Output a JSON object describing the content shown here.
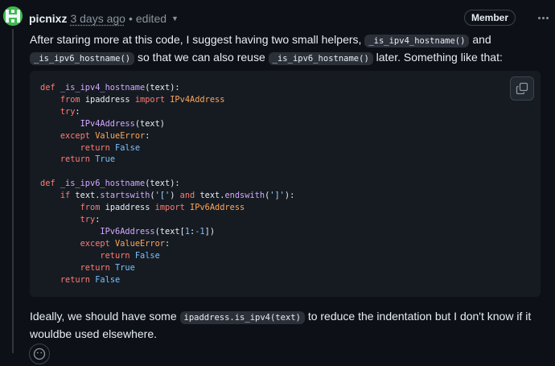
{
  "comment": {
    "author": "picnixz",
    "time": "3 days ago",
    "separator": "•",
    "edited": "edited",
    "badge": "Member",
    "paragraph1": {
      "t1": "After staring more at this code, I suggest having two small helpers,",
      "c1": "_is_ipv4_hostname()",
      "t2": "and",
      "c2": "_is_ipv6_hostname()",
      "t3": "so that we can also reuse",
      "c3": "_is_ipv6_hostname()",
      "t4": "later. Something like that:"
    },
    "code_lines": [
      [
        {
          "t": "def ",
          "c": "kw"
        },
        {
          "t": "_is_ipv4_hostname",
          "c": "fn"
        },
        {
          "t": "(text):",
          "c": ""
        }
      ],
      [
        {
          "t": "    ",
          "c": ""
        },
        {
          "t": "from",
          "c": "kw"
        },
        {
          "t": " ipaddress ",
          "c": ""
        },
        {
          "t": "import",
          "c": "kw"
        },
        {
          "t": " ",
          "c": ""
        },
        {
          "t": "IPv4Address",
          "c": "cls"
        }
      ],
      [
        {
          "t": "    ",
          "c": ""
        },
        {
          "t": "try",
          "c": "kw"
        },
        {
          "t": ":",
          "c": ""
        }
      ],
      [
        {
          "t": "        ",
          "c": ""
        },
        {
          "t": "IPv4Address",
          "c": "fn"
        },
        {
          "t": "(text)",
          "c": ""
        }
      ],
      [
        {
          "t": "    ",
          "c": ""
        },
        {
          "t": "except",
          "c": "kw"
        },
        {
          "t": " ",
          "c": ""
        },
        {
          "t": "ValueError",
          "c": "cls"
        },
        {
          "t": ":",
          "c": ""
        }
      ],
      [
        {
          "t": "        ",
          "c": ""
        },
        {
          "t": "return",
          "c": "kw"
        },
        {
          "t": " ",
          "c": ""
        },
        {
          "t": "False",
          "c": "cn"
        }
      ],
      [
        {
          "t": "    ",
          "c": ""
        },
        {
          "t": "return",
          "c": "kw"
        },
        {
          "t": " ",
          "c": ""
        },
        {
          "t": "True",
          "c": "cn"
        }
      ],
      [],
      [
        {
          "t": "def ",
          "c": "kw"
        },
        {
          "t": "_is_ipv6_hostname",
          "c": "fn"
        },
        {
          "t": "(text):",
          "c": ""
        }
      ],
      [
        {
          "t": "    ",
          "c": ""
        },
        {
          "t": "if",
          "c": "kw"
        },
        {
          "t": " text.",
          "c": ""
        },
        {
          "t": "startswith",
          "c": "fn"
        },
        {
          "t": "(",
          "c": ""
        },
        {
          "t": "'['",
          "c": "str"
        },
        {
          "t": ") ",
          "c": ""
        },
        {
          "t": "and",
          "c": "kw"
        },
        {
          "t": " text.",
          "c": ""
        },
        {
          "t": "endswith",
          "c": "fn"
        },
        {
          "t": "(",
          "c": ""
        },
        {
          "t": "']'",
          "c": "str"
        },
        {
          "t": "):",
          "c": ""
        }
      ],
      [
        {
          "t": "        ",
          "c": ""
        },
        {
          "t": "from",
          "c": "kw"
        },
        {
          "t": " ipaddress ",
          "c": ""
        },
        {
          "t": "import",
          "c": "kw"
        },
        {
          "t": " ",
          "c": ""
        },
        {
          "t": "IPv6Address",
          "c": "cls"
        }
      ],
      [
        {
          "t": "        ",
          "c": ""
        },
        {
          "t": "try",
          "c": "kw"
        },
        {
          "t": ":",
          "c": ""
        }
      ],
      [
        {
          "t": "            ",
          "c": ""
        },
        {
          "t": "IPv6Address",
          "c": "fn"
        },
        {
          "t": "(text[",
          "c": ""
        },
        {
          "t": "1",
          "c": "cn"
        },
        {
          "t": ":",
          "c": ""
        },
        {
          "t": "-1",
          "c": "cn"
        },
        {
          "t": "])",
          "c": ""
        }
      ],
      [
        {
          "t": "        ",
          "c": ""
        },
        {
          "t": "except",
          "c": "kw"
        },
        {
          "t": " ",
          "c": ""
        },
        {
          "t": "ValueError",
          "c": "cls"
        },
        {
          "t": ":",
          "c": ""
        }
      ],
      [
        {
          "t": "            ",
          "c": ""
        },
        {
          "t": "return",
          "c": "kw"
        },
        {
          "t": " ",
          "c": ""
        },
        {
          "t": "False",
          "c": "cn"
        }
      ],
      [
        {
          "t": "        ",
          "c": ""
        },
        {
          "t": "return",
          "c": "kw"
        },
        {
          "t": " ",
          "c": ""
        },
        {
          "t": "True",
          "c": "cn"
        }
      ],
      [
        {
          "t": "    ",
          "c": ""
        },
        {
          "t": "return",
          "c": "kw"
        },
        {
          "t": " ",
          "c": ""
        },
        {
          "t": "False",
          "c": "cn"
        }
      ]
    ],
    "paragraph2": {
      "t1": "Ideally, we should have some",
      "c1": "ipaddress.is_ipv4(text)",
      "t2": "to reduce the indentation but I don't know if it wouldbe used elsewhere."
    }
  },
  "icons": {
    "avatar": "identicon-avatar",
    "caret": "chevron-down-icon",
    "kebab": "kebab-horizontal-icon",
    "copy": "copy-icon",
    "reaction": "smiley-icon"
  },
  "colors": {
    "background": "#0d1117",
    "code_background": "#161b22",
    "keyword": "#ff7b72",
    "function": "#d2a8ff",
    "class": "#ffa657",
    "constant": "#79c0ff",
    "string": "#a5d6ff"
  }
}
